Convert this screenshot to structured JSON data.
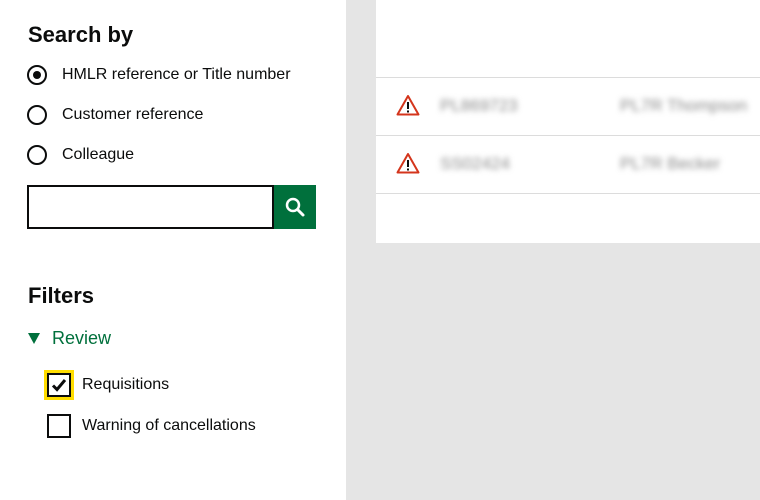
{
  "search": {
    "heading": "Search by",
    "options": [
      {
        "label": "HMLR reference or Title number",
        "selected": true
      },
      {
        "label": "Customer reference",
        "selected": false
      },
      {
        "label": "Colleague",
        "selected": false
      }
    ],
    "input_value": "",
    "button_icon": "search-icon"
  },
  "filters": {
    "heading": "Filters",
    "review_label": "Review",
    "review_expanded": true,
    "checkboxes": [
      {
        "label": "Requisitions",
        "checked": true,
        "focused": true
      },
      {
        "label": "Warning of cancellations",
        "checked": false,
        "focused": false
      }
    ]
  },
  "results": {
    "rows": [
      {
        "icon": "warning-icon",
        "reference": "PL869723",
        "name": "PL7R Thompson"
      },
      {
        "icon": "warning-icon",
        "reference": "SS02424",
        "name": "PL7R Becker"
      }
    ]
  },
  "colors": {
    "accent_green": "#00703c",
    "focus_yellow": "#ffdd00",
    "warning_red": "#d4351c",
    "background_grey": "#e5e5e5"
  }
}
